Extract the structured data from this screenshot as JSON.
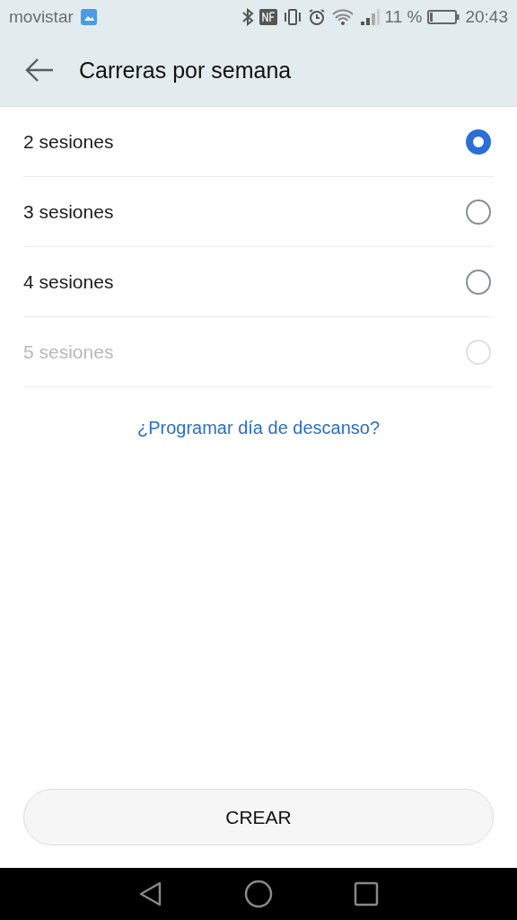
{
  "status_bar": {
    "carrier": "movistar",
    "battery_percent": "11 %",
    "time": "20:43"
  },
  "app_bar": {
    "title": "Carreras por semana"
  },
  "options": [
    {
      "label": "2 sesiones",
      "selected": true,
      "disabled": false
    },
    {
      "label": "3 sesiones",
      "selected": false,
      "disabled": false
    },
    {
      "label": "4 sesiones",
      "selected": false,
      "disabled": false
    },
    {
      "label": "5 sesiones",
      "selected": false,
      "disabled": true
    }
  ],
  "rest_day_link": "¿Programar día de descanso?",
  "create_button": "CREAR"
}
